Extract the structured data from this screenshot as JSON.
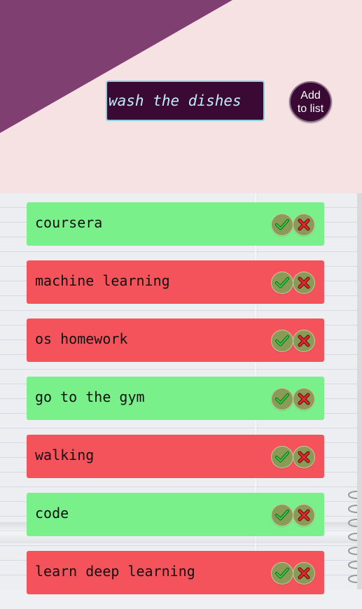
{
  "header": {
    "input": {
      "value": "wash the dishes"
    },
    "add_button_label": "Add to list",
    "colors": {
      "background": "#f6e1e3",
      "triangle": "#7f3f71",
      "input_bg": "#3a0a34"
    }
  },
  "tasks": [
    {
      "label": "coursera",
      "status": "done"
    },
    {
      "label": "machine learning",
      "status": "pending"
    },
    {
      "label": "os homework",
      "status": "pending"
    },
    {
      "label": "go to the gym",
      "status": "done"
    },
    {
      "label": "walking",
      "status": "pending"
    },
    {
      "label": "code",
      "status": "done"
    },
    {
      "label": "learn deep learning",
      "status": "pending"
    }
  ],
  "icons": {
    "complete": "check-icon",
    "delete": "cross-icon"
  },
  "status_colors": {
    "done": "#7af08a",
    "pending": "#f5535c"
  }
}
